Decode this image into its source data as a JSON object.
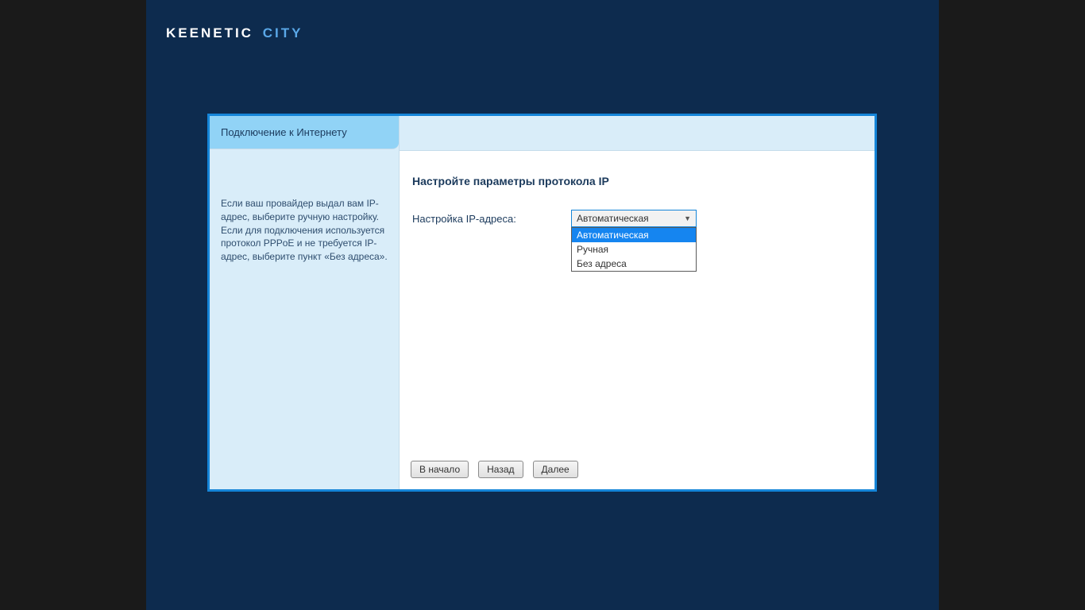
{
  "logo": {
    "brand": "KEENETIC",
    "model": "CITY"
  },
  "sidebar": {
    "tab_label": "Подключение к Интернету",
    "help_text": "Если ваш провайдер выдал вам IP-адрес, выберите ручную настройку. Если для подключения используется протокол PPPoE и не требуется IP-адрес, выберите пункт «Без адреса»."
  },
  "main": {
    "heading": "Настройте параметры протокола IP",
    "ip_label": "Настройка IP-адреса:",
    "ip_select": {
      "value": "Автоматическая",
      "options": [
        "Автоматическая",
        "Ручная",
        "Без адреса"
      ],
      "selected_index": 0
    }
  },
  "buttons": {
    "start": "В начало",
    "back": "Назад",
    "next": "Далее"
  }
}
